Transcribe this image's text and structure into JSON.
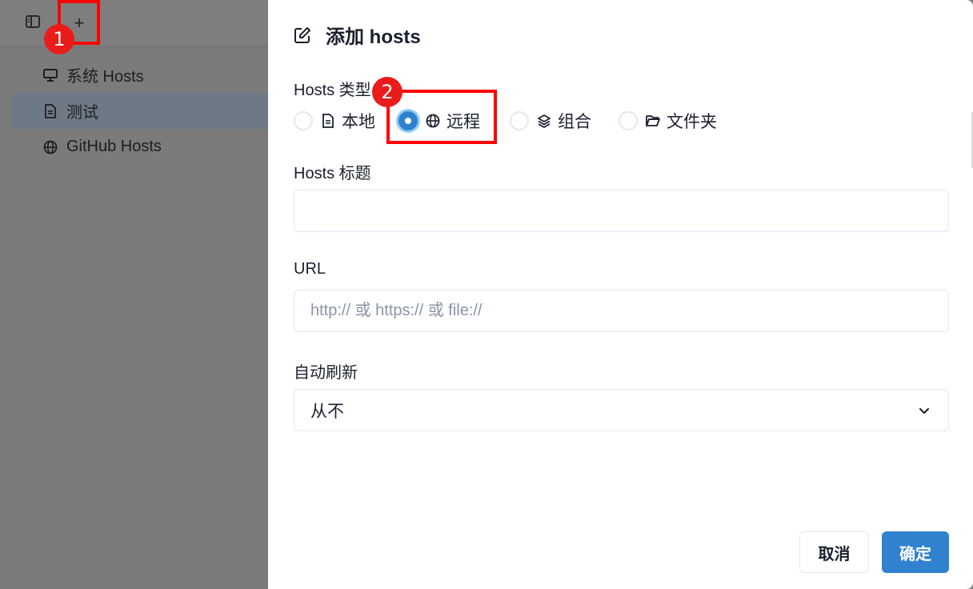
{
  "toolbar": {
    "sidebar_toggle_icon": "sidebar-icon",
    "add_icon": "plus-icon",
    "add_symbol": "+"
  },
  "annotations": {
    "badge1": "1",
    "badge2": "2",
    "highlight_color": "#ff0000"
  },
  "sidebar": {
    "items": [
      {
        "label": "系统 Hosts",
        "icon": "monitor-icon",
        "active": false
      },
      {
        "label": "测试",
        "icon": "file-icon",
        "active": true
      },
      {
        "label": "GitHub Hosts",
        "icon": "globe-icon",
        "active": false
      }
    ]
  },
  "dialog": {
    "title": "添加 hosts",
    "title_icon": "edit-icon",
    "type_label": "Hosts 类型",
    "types": [
      {
        "label": "本地",
        "icon": "file-icon",
        "checked": false
      },
      {
        "label": "远程",
        "icon": "globe-icon",
        "checked": true
      },
      {
        "label": "组合",
        "icon": "layers-icon",
        "checked": false
      },
      {
        "label": "文件夹",
        "icon": "folder-icon",
        "checked": false
      }
    ],
    "title_field_label": "Hosts 标题",
    "title_field_value": "",
    "url_label": "URL",
    "url_placeholder": "http:// 或 https:// 或 file://",
    "url_value": "",
    "refresh_label": "自动刷新",
    "refresh_value": "从不",
    "cancel_label": "取消",
    "ok_label": "确定"
  },
  "colors": {
    "accent": "#3182ce",
    "overlay": "#7b7b7c",
    "active_item": "#6e7988"
  }
}
